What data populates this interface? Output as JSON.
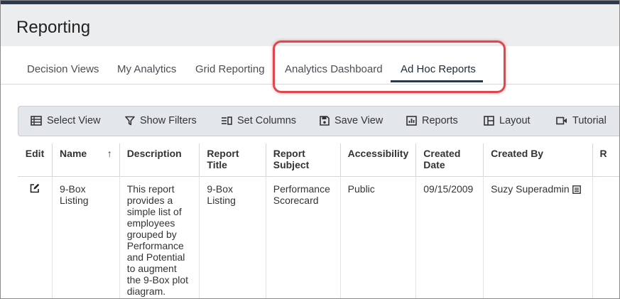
{
  "header": {
    "title": "Reporting"
  },
  "tabs": [
    {
      "label": "Decision Views"
    },
    {
      "label": "My Analytics"
    },
    {
      "label": "Grid Reporting"
    },
    {
      "label": "Analytics Dashboard"
    },
    {
      "label": "Ad Hoc Reports"
    }
  ],
  "active_tab": "Ad Hoc Reports",
  "toolbar": {
    "select_view": "Select View",
    "show_filters": "Show Filters",
    "set_columns": "Set Columns",
    "save_view": "Save View",
    "reports": "Reports",
    "layout": "Layout",
    "tutorial": "Tutorial"
  },
  "table": {
    "headers": {
      "edit": "Edit",
      "name": "Name",
      "description": "Description",
      "report_title": "Report Title",
      "report_subject": "Report Subject",
      "accessibility": "Accessibility",
      "created_date": "Created Date",
      "created_by": "Created By",
      "more": "R"
    },
    "rows": [
      {
        "name": "9-Box Listing",
        "description": "This report provides a simple list of employees grouped by Performance and Potential to augment the 9-Box plot diagram.",
        "report_title": "9-Box Listing",
        "report_subject": "Performance Scorecard",
        "accessibility": "Public",
        "created_date": "09/15/2009",
        "created_by": "Suzy Superadmin"
      }
    ]
  },
  "colors": {
    "highlight": "#e0474c",
    "active_tab_underline": "#1d3a66",
    "toolbar_bg": "#e3e7ec"
  },
  "icons": [
    "table-list-icon",
    "filter-icon",
    "columns-icon",
    "save-icon",
    "chart-icon",
    "layout-icon",
    "video-icon",
    "edit-icon",
    "details-icon"
  ]
}
